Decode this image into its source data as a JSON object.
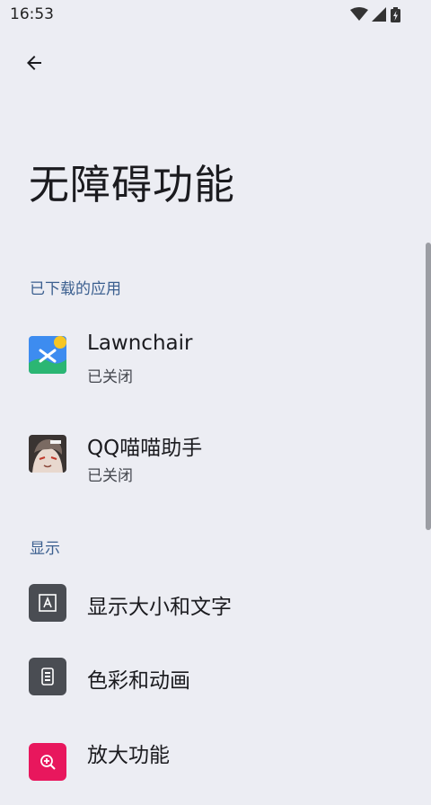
{
  "status_bar": {
    "time": "16:53",
    "icons": [
      "wifi-icon",
      "signal-icon",
      "battery-charging-icon"
    ]
  },
  "header": {
    "back_icon": "arrow-back-icon",
    "title": "无障碍功能"
  },
  "downloaded_apps": {
    "header": "已下载的应用",
    "items": [
      {
        "name": "Lawnchair",
        "status": "已关闭",
        "icon": "lawnchair-app-icon"
      },
      {
        "name": "QQ喵喵助手",
        "status": "已关闭",
        "icon": "qq-miaomiao-app-icon"
      }
    ]
  },
  "display": {
    "header": "显示",
    "items": [
      {
        "label": "显示大小和文字",
        "icon": "text-size-icon"
      },
      {
        "label": "色彩和动画",
        "icon": "color-motion-icon"
      },
      {
        "label": "放大功能",
        "icon": "magnification-icon"
      }
    ]
  },
  "colors": {
    "background": "#ECEDF3",
    "section_header": "#3B5F8F",
    "icon_tile": "#4A4D53",
    "magnify_tile": "#E8175D"
  }
}
